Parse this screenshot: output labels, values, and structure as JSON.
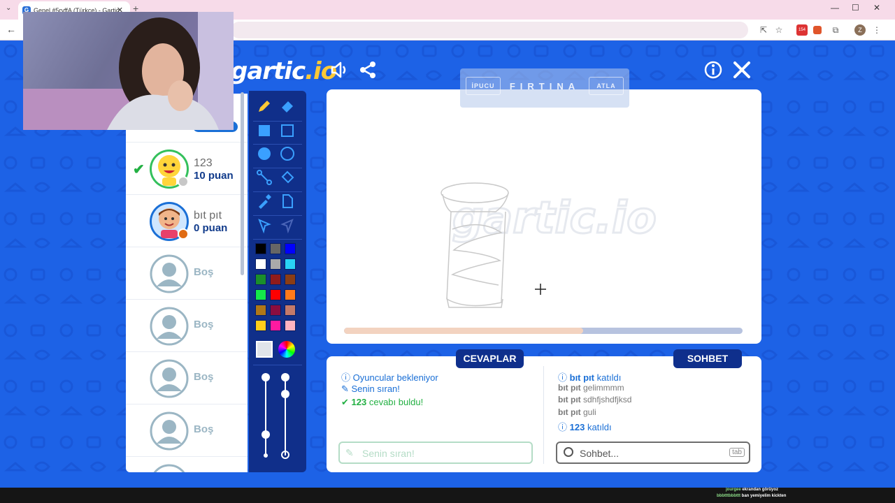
{
  "browser": {
    "tab_title": "Genel #5ryffA (Türkçe) - Gartic",
    "tab_favicon": "G",
    "new_tab": "+",
    "tab_close": "✕",
    "extension_badge": "154",
    "profile_initial": "Z"
  },
  "game": {
    "logo_main": "gartic",
    "logo_suffix": ".io",
    "hint": {
      "word": "FIRTINA",
      "left_label": "İPUCU",
      "right_label": "ATLA"
    },
    "timer_progress": 0.6,
    "players": [
      {
        "name": "123",
        "score": "10 puan",
        "guessed": true,
        "status": "#c7c7c7"
      },
      {
        "name": "bıt pıt",
        "score": "0 puan",
        "guessed": false,
        "status": "#e06b13"
      },
      {
        "name": "Boş"
      },
      {
        "name": "Boş"
      },
      {
        "name": "Boş"
      },
      {
        "name": "Boş"
      }
    ],
    "owner_badge": "Oda Sahibi",
    "palette": [
      "#000000",
      "#666666",
      "#0000ff",
      "#ffffff",
      "#aaaaaa",
      "#29d3f5",
      "#1a8f2b",
      "#8f1b1b",
      "#8b3d14",
      "#14e84a",
      "#ff0000",
      "#ff7a1a",
      "#b07718",
      "#8a0d3f",
      "#c47a6a",
      "#ffce1a",
      "#ff1aa0",
      "#ffb3c0"
    ],
    "answers": {
      "header": "CEVAPLAR",
      "messages": [
        {
          "icon": "info-icon",
          "text": "Oyuncular bekleniyor"
        },
        {
          "icon": "pencil-icon",
          "text": "Senin sıran!"
        },
        {
          "icon": "check-icon",
          "name": "123",
          "text": "cevabı buldu!"
        }
      ],
      "input_placeholder": "Senin sıran!"
    },
    "chat": {
      "header": "SOHBET",
      "messages": [
        {
          "icon": "info-icon",
          "name": "bıt pıt",
          "text": "katıldı"
        },
        {
          "name": "bıt pıt",
          "text": "gelimmmm"
        },
        {
          "name": "bıt pıt",
          "text": "sdhfjshdfjksd"
        },
        {
          "name": "bıt pıt",
          "text": "guli"
        },
        {
          "icon": "info-icon",
          "name": "123",
          "text": "katıldı"
        }
      ],
      "input_placeholder": "Sohbet...",
      "tab_hint": "tab"
    }
  },
  "stream_chat": [
    {
      "user": "jourgee",
      "text": "ekrandan görüyoz"
    },
    {
      "user": "bbbtttbbbttt",
      "text": "ban yemiyelim kickten"
    }
  ]
}
